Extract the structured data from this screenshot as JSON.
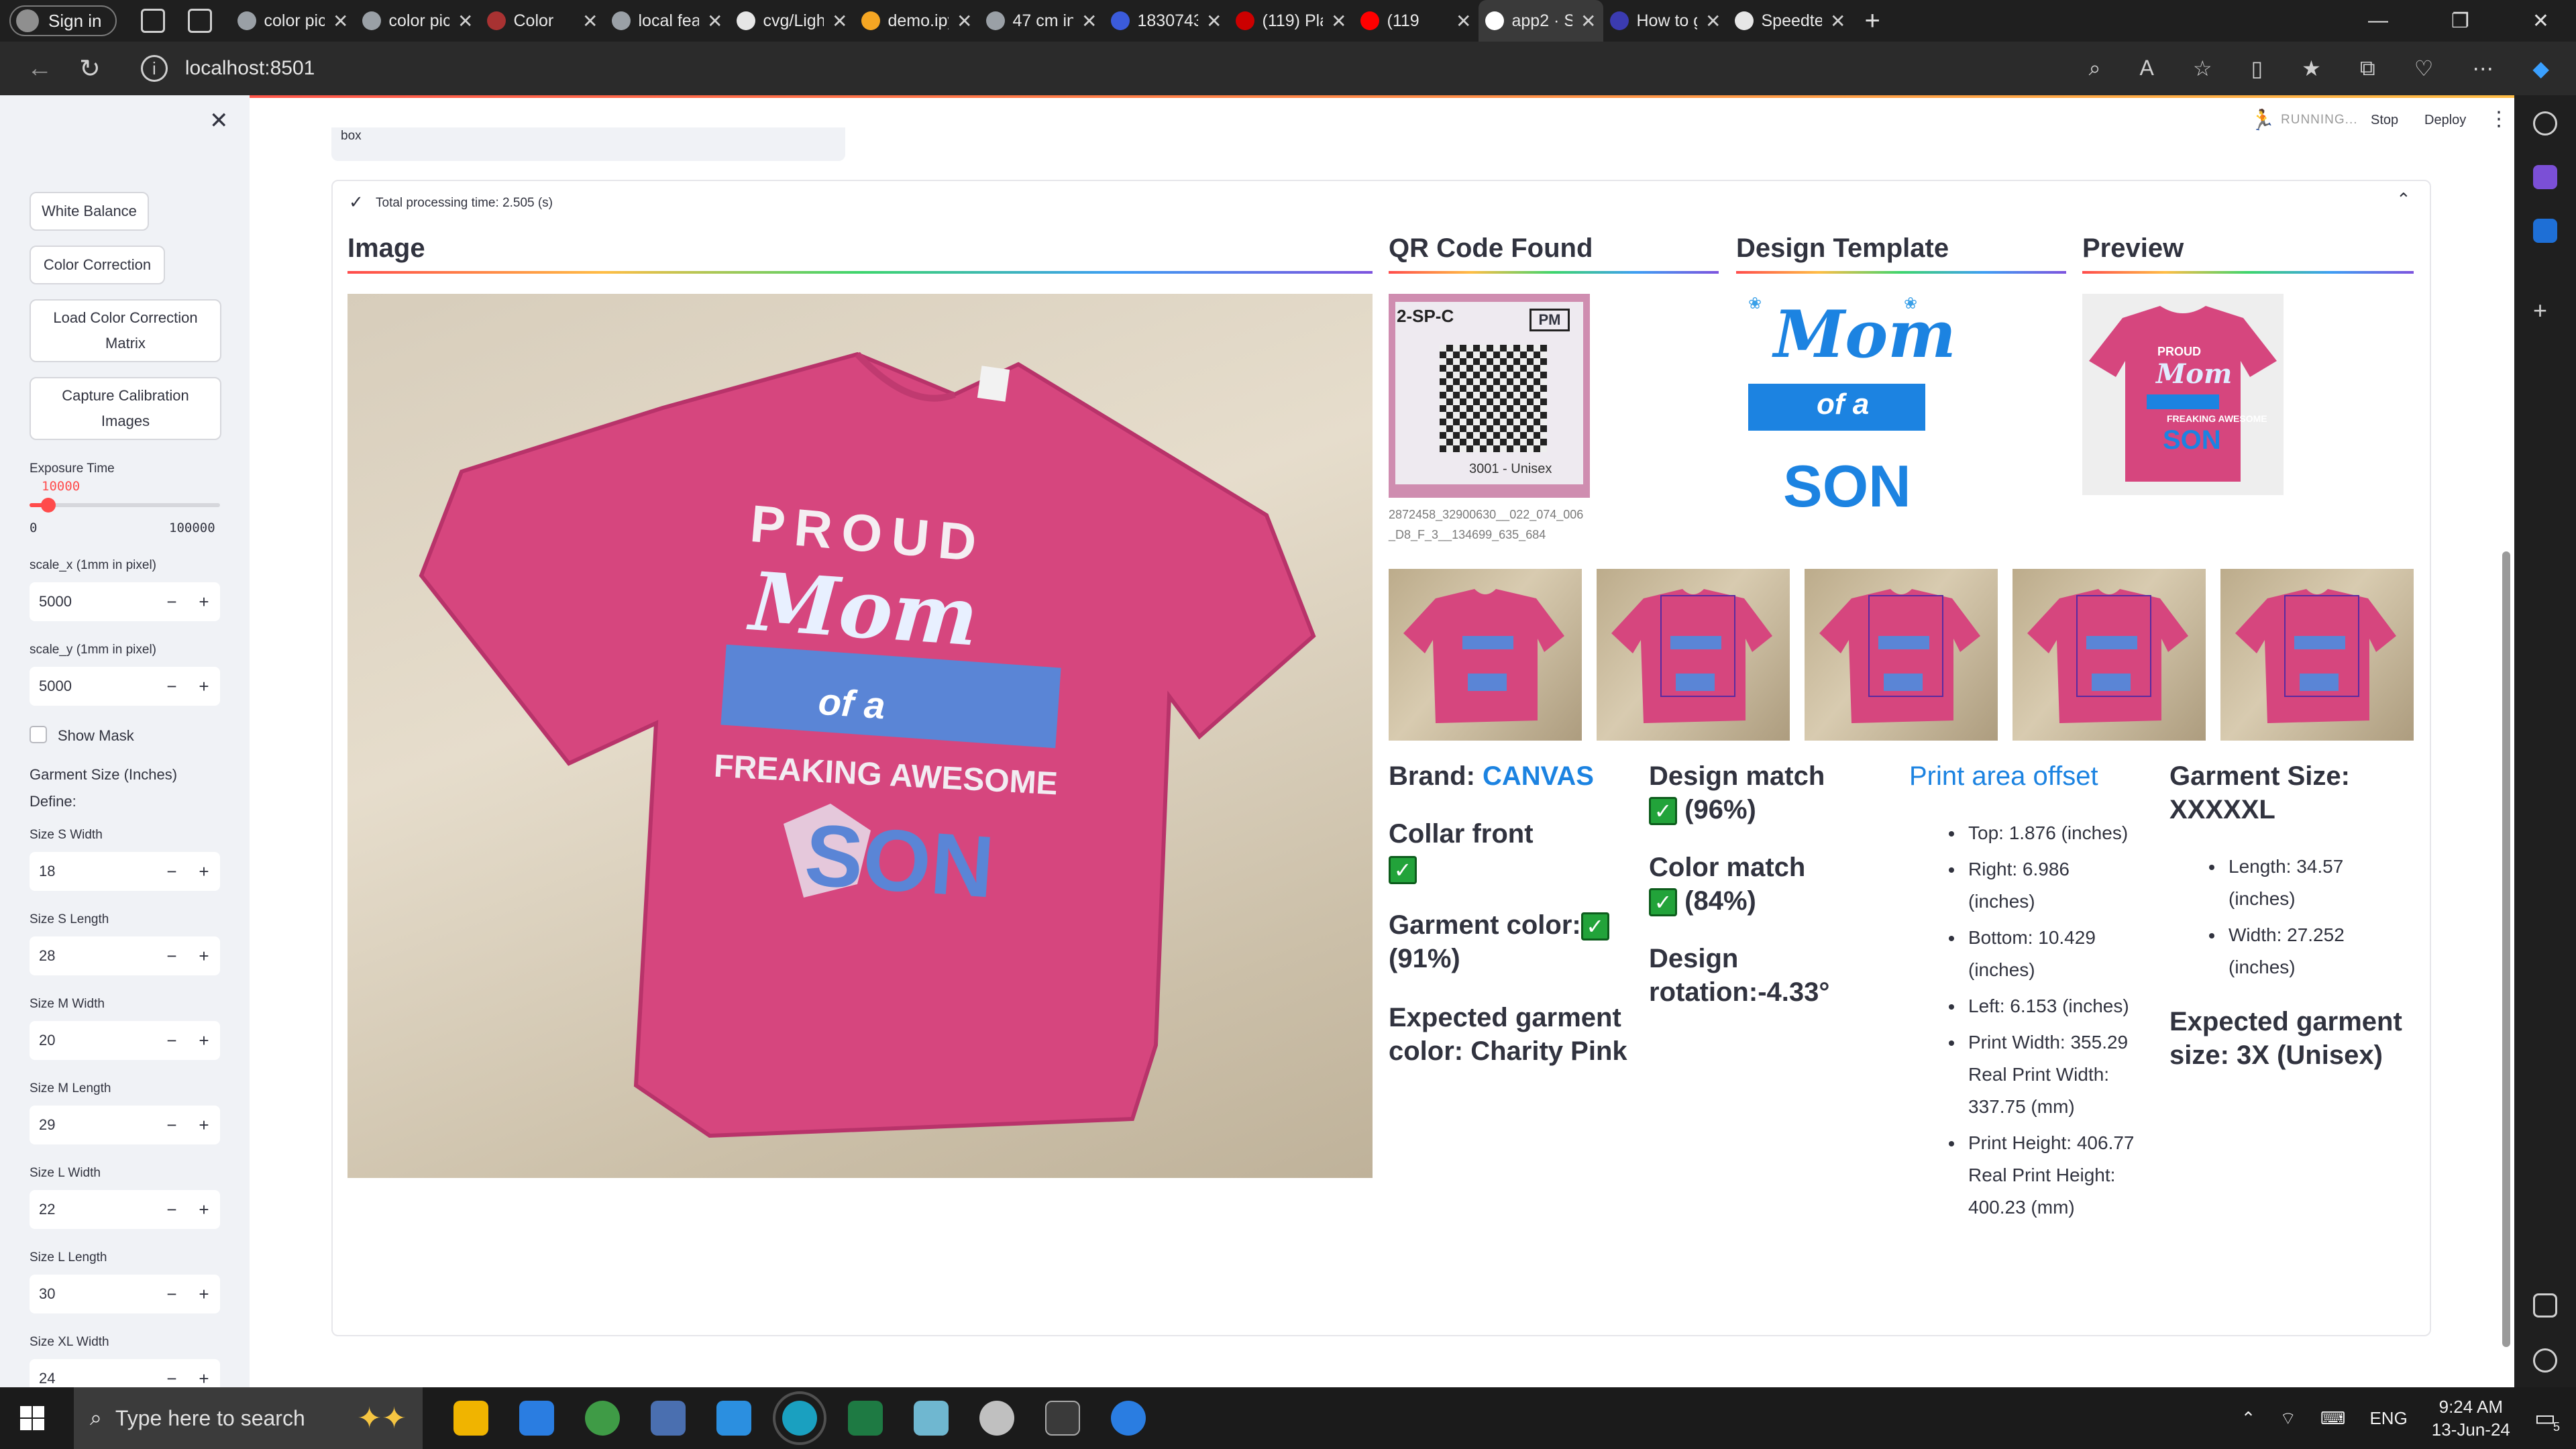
{
  "browser": {
    "signin_label": "Sign in",
    "tabs": [
      {
        "title": "color pick",
        "color": "#9aa0a6"
      },
      {
        "title": "color pick",
        "color": "#9aa0a6"
      },
      {
        "title": "Color",
        "color": "#a83232"
      },
      {
        "title": "local featu",
        "color": "#9aa0a6"
      },
      {
        "title": "cvg/Light",
        "color": "#e6e6e6"
      },
      {
        "title": "demo.ipy",
        "color": "#f5a623"
      },
      {
        "title": "47 cm in",
        "color": "#9aa0a6"
      },
      {
        "title": "1830743",
        "color": "#3b5bdb"
      },
      {
        "title": "(119) Play",
        "color": "#cc0000"
      },
      {
        "title": "(119",
        "color": "#ff0000"
      },
      {
        "title": "app2 · Str",
        "color": "#ffffff",
        "active": true
      },
      {
        "title": "How to g",
        "color": "#3b3bb0"
      },
      {
        "title": "Speedtest",
        "color": "#e6e6e6"
      }
    ],
    "url": "localhost:8501"
  },
  "app": {
    "status": "RUNNING...",
    "stop_label": "Stop",
    "deploy_label": "Deploy"
  },
  "sidebar": {
    "buttons": [
      "White Balance",
      "Color Correction",
      "Load Color Correction Matrix",
      "Capture Calibration Images"
    ],
    "exposure": {
      "label": "Exposure Time",
      "value": "10000",
      "min": "0",
      "max": "100000",
      "fraction": 0.1
    },
    "scale_x": {
      "label": "scale_x (1mm in pixel)",
      "value": "5000"
    },
    "scale_y": {
      "label": "scale_y (1mm in pixel)",
      "value": "5000"
    },
    "show_mask_label": "Show Mask",
    "garment_size_label": "Garment Size (Inches)",
    "define_label": "Define:",
    "fields": [
      {
        "label": "Size S Width",
        "value": "18"
      },
      {
        "label": "Size S Length",
        "value": "28"
      },
      {
        "label": "Size M Width",
        "value": "20"
      },
      {
        "label": "Size M Length",
        "value": "29"
      },
      {
        "label": "Size L Width",
        "value": "22"
      },
      {
        "label": "Size L Length",
        "value": "30"
      },
      {
        "label": "Size XL Width",
        "value": "24"
      }
    ]
  },
  "main": {
    "box_text": "box",
    "processing_label": "Total processing time: 2.505 (s)",
    "headers": {
      "image": "Image",
      "qr": "QR Code Found",
      "design": "Design Template",
      "preview": "Preview"
    },
    "qr_caption": "2872458_32900630__022_074_006_D8_F_3__134699_635_684",
    "qr_code_text": {
      "top": "2-SP-C",
      "tag": "PM",
      "bottom": "3001 - Unisex"
    },
    "shirt_text": {
      "line1": "PROUD",
      "line2": "Mom",
      "line3": "of a",
      "line4": "FREAKING AWESOME",
      "line5": "SON"
    },
    "brand": {
      "label": "Brand:",
      "value": "CANVAS"
    },
    "collar_label": "Collar front",
    "garment_color": {
      "label": "Garment color:",
      "pct": "(91%)"
    },
    "expected_color": "Expected garment color: Charity Pink",
    "design_match": {
      "label": "Design match",
      "pct": "(96%)"
    },
    "color_match": {
      "label": "Color match",
      "pct": "(84%)"
    },
    "design_rotation": "Design rotation:-4.33°",
    "print_area": {
      "title": "Print area offset",
      "items": [
        [
          "Top: 1.876 (inches)"
        ],
        [
          "Right: 6.986",
          "(inches)"
        ],
        [
          "Bottom: 10.429",
          "(inches)"
        ],
        [
          "Left: 6.153 (inches)"
        ],
        [
          "Print Width: 355.29",
          "Real Print Width:",
          "337.75 (mm)"
        ],
        [
          "Print Height: 406.77",
          "Real Print Height:",
          "400.23 (mm)"
        ]
      ]
    },
    "garment_size": {
      "title": "Garment Size:",
      "value": "XXXXXL",
      "items": [
        [
          "Length: 34.57",
          "(inches)"
        ],
        [
          "Width: 27.252",
          "(inches)"
        ]
      ],
      "expected": "Expected garment size: 3X (Unisex)"
    }
  },
  "taskbar": {
    "search_placeholder": "Type here to search",
    "lang": "ENG",
    "time": "9:24 AM",
    "date": "13-Jun-24",
    "notifications": "5"
  },
  "colors": {
    "shirt": "#d6467e",
    "design_blue": "#5a85d6",
    "accent": "#ff4b4b"
  }
}
